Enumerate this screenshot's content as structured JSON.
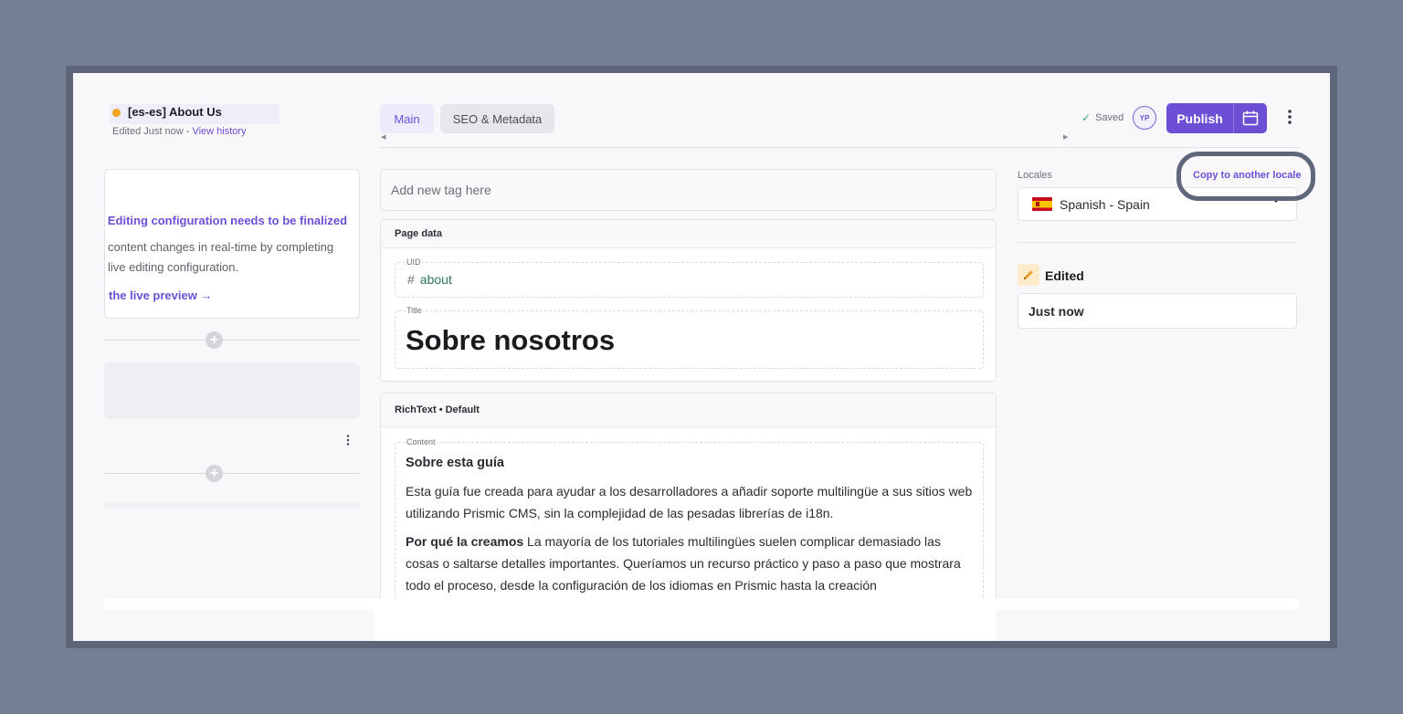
{
  "document": {
    "title": "[es-es] About Us",
    "edited_prefix": "Edited Just now - ",
    "history_link": "View history"
  },
  "tabs": [
    {
      "label": "Main",
      "active": true
    },
    {
      "label": "SEO & Metadata",
      "active": false
    }
  ],
  "toolbar": {
    "saved_label": "Saved",
    "avatar_initials": "YP",
    "publish_label": "Publish"
  },
  "left_panel": {
    "notice_title": "e Editing configuration needs to be finalized",
    "notice_line1": "content changes in real-time by completing",
    "notice_line2": "live editing configuration.",
    "preview_link": "the live preview →"
  },
  "tag_input": {
    "placeholder": "Add new tag here"
  },
  "page_data": {
    "section_title": "Page data",
    "uid_label": "UID",
    "uid_value": "about",
    "title_label": "Title",
    "title_value": "Sobre nosotros"
  },
  "richtext": {
    "section_title": "RichText • Default",
    "content_label": "Content",
    "heading": "Sobre esta guía",
    "paragraph1": "Esta guía fue creada para ayudar a los desarrolladores a añadir soporte multilingüe a sus sitios web utilizando Prismic CMS, sin la complejidad de las pesadas librerías de i18n.",
    "paragraph2_bold": "Por qué la creamos",
    "paragraph2_text": " La mayoría de los tutoriales multilingües suelen complicar demasiado las cosas o saltarse detalles importantes. Queríamos un recurso práctico y paso a paso que mostrara todo el proceso, desde la configuración de los idiomas en Prismic hasta la creación"
  },
  "right_panel": {
    "locales_label": "Locales",
    "copy_link": "Copy to another locale",
    "selected_locale": "Spanish - Spain",
    "status_label": "Edited",
    "status_value": "Just now"
  },
  "colors": {
    "accent": "#6d4fd6",
    "status_dot": "#f5a524",
    "saved_check": "#3aa77a",
    "uid_text": "#2f7a55"
  },
  "icons": [
    "status-dot",
    "chevron-left-icon",
    "chevron-right-icon",
    "check-icon",
    "calendar-icon",
    "kebab-menu-icon",
    "plus-circle-icon",
    "hash-icon",
    "spain-flag-icon",
    "chevron-down-icon",
    "pencil-icon",
    "arrow-right-icon"
  ]
}
